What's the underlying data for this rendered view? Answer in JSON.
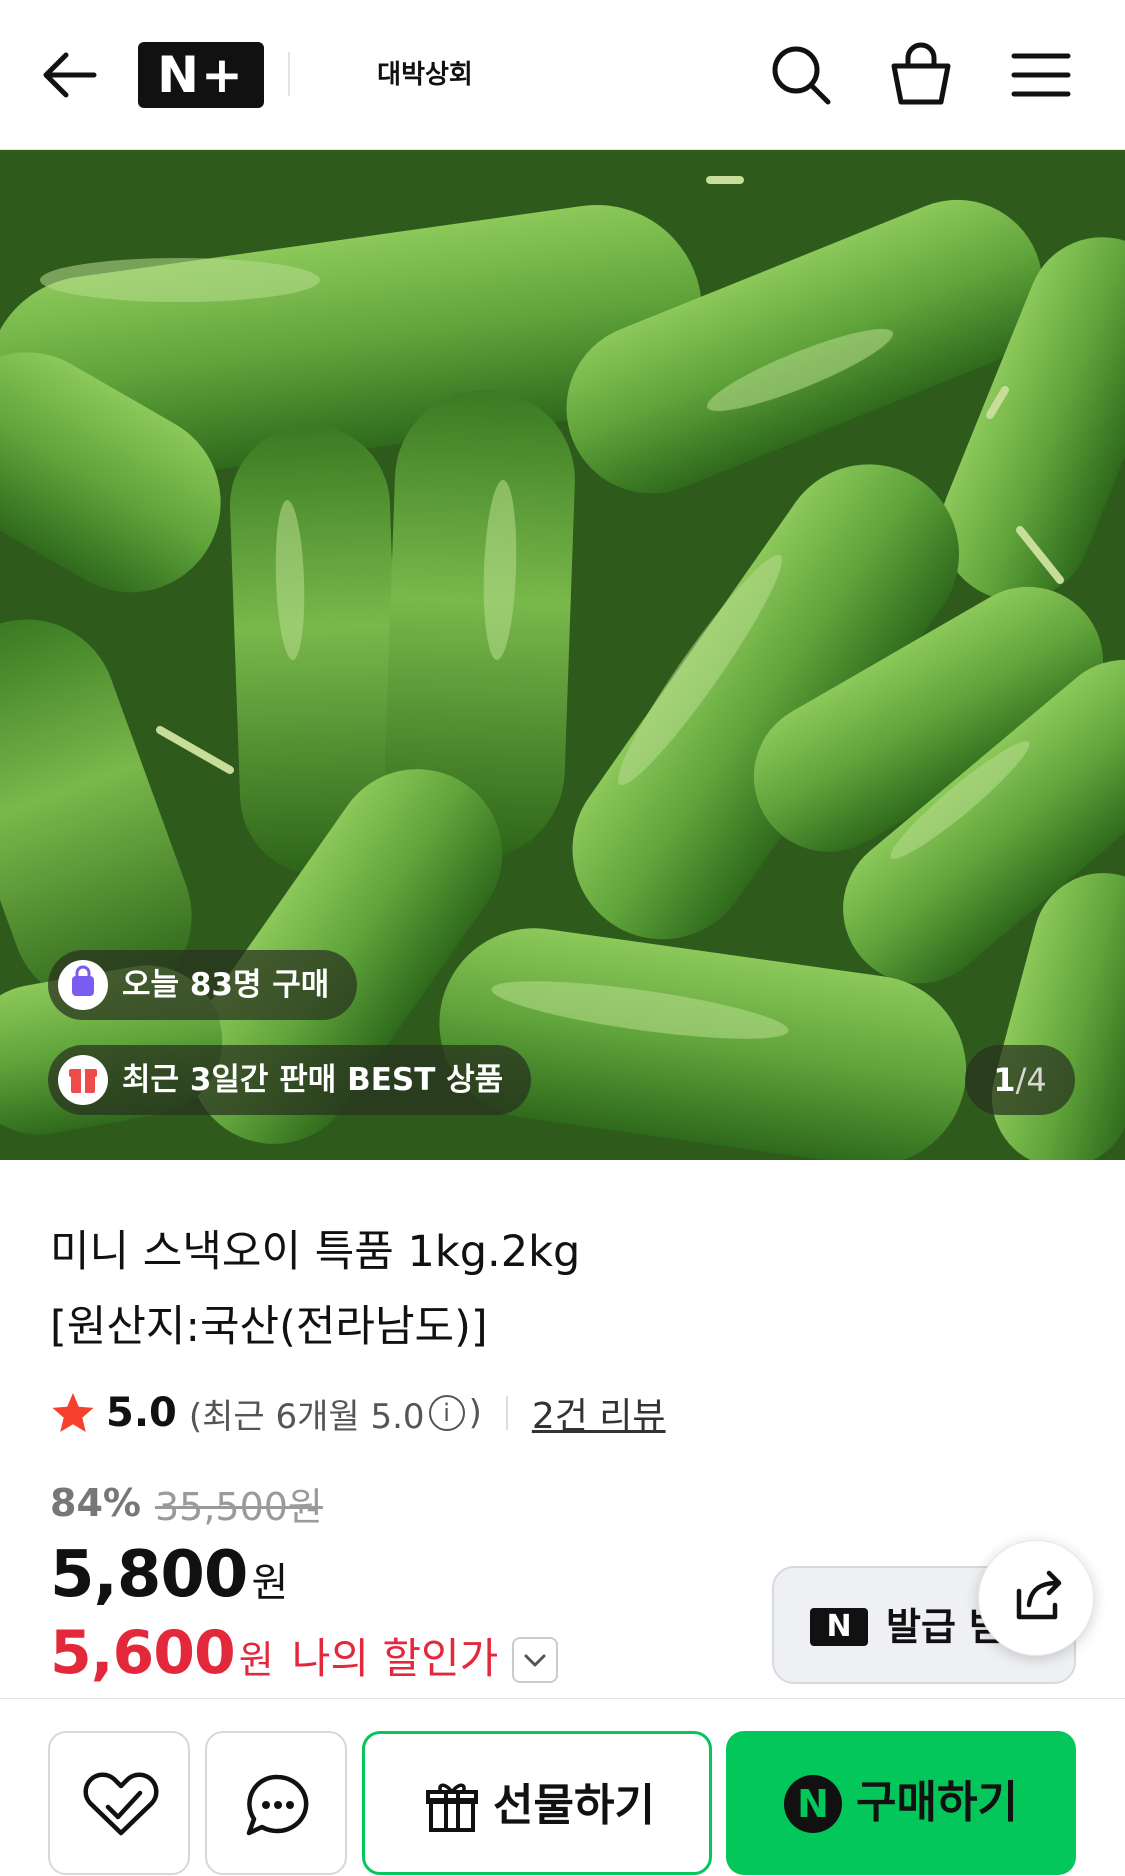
{
  "header": {
    "logo_text": "N+",
    "store_name": "대박상회",
    "icons": [
      "back-arrow-icon",
      "search-icon",
      "shopping-bag-icon",
      "menu-icon"
    ]
  },
  "hero": {
    "badges": [
      {
        "text": "오늘 83명 구매",
        "icon": "bag-icon",
        "icon_color": "#7b5cf0"
      },
      {
        "text": "최근 3일간 판매 BEST 상품",
        "icon": "gift-icon",
        "icon_color": "#f04b4b"
      }
    ],
    "counter": {
      "current": "1",
      "total": "/4"
    }
  },
  "product": {
    "title_line1": "미니 스낵오이 특품 1kg.2kg",
    "title_line2": "[원산지:국산(전라남도)]",
    "rating": {
      "score": "5.0",
      "recent_prefix": "(최근 6개월 5.0",
      "recent_suffix": ")",
      "review_link": "2건 리뷰"
    },
    "price": {
      "discount_rate": "84%",
      "original": "35,500원",
      "current": "5,800",
      "current_unit": "원",
      "my_price": "5,600",
      "my_unit": "원",
      "my_label": "나의 할인가"
    },
    "coupon_label": "발급 받"
  },
  "bottom_bar": {
    "gift_label": "선물하기",
    "buy_label": "구매하기"
  },
  "colors": {
    "naver_green": "#03c75a",
    "sale_red": "#e4283b",
    "star_red": "#f5402c"
  }
}
